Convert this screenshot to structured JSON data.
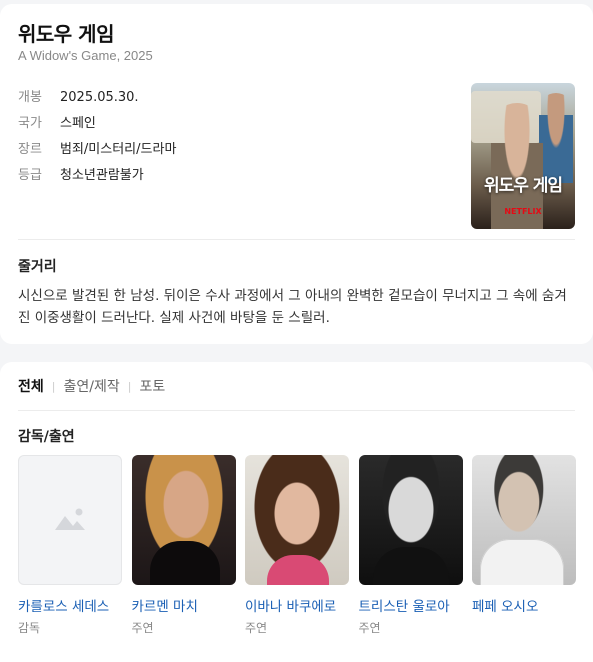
{
  "movie": {
    "title": "위도우 게임",
    "subtitle": "A Widow's Game, 2025",
    "poster_title": "위도우 게임",
    "info": [
      {
        "label": "개봉",
        "value": "2025.05.30."
      },
      {
        "label": "국가",
        "value": "스페인"
      },
      {
        "label": "장르",
        "value": "범죄/미스터리/드라마"
      },
      {
        "label": "등급",
        "value": "청소년관람불가"
      }
    ],
    "synopsis_heading": "줄거리",
    "synopsis": "시신으로 발견된 한 남성. 뒤이은 수사 과정에서 그 아내의 완벽한 겉모습이 무너지고 그 속에 숨겨진 이중생활이 드러난다. 실제 사건에 바탕을 둔 스릴러."
  },
  "tabs": [
    {
      "label": "전체",
      "active": true
    },
    {
      "label": "출연/제작",
      "active": false
    },
    {
      "label": "포토",
      "active": false
    }
  ],
  "cast_heading": "감독/출연",
  "cast": [
    {
      "name": "카를로스 세데스",
      "role": "감독",
      "photo": "placeholder-image-icon"
    },
    {
      "name": "카르멘 마치",
      "role": "주연",
      "photo": "actor-photo"
    },
    {
      "name": "이바나 바쿠에로",
      "role": "주연",
      "photo": "actor-photo"
    },
    {
      "name": "트리스탄 울로아",
      "role": "주연",
      "photo": "actor-photo"
    },
    {
      "name": "페페 오시오",
      "role": "",
      "photo": "actor-photo"
    }
  ],
  "colors": {
    "link": "#1a5fb4",
    "label": "#8a8a8a",
    "background": "#f4f5f7"
  }
}
